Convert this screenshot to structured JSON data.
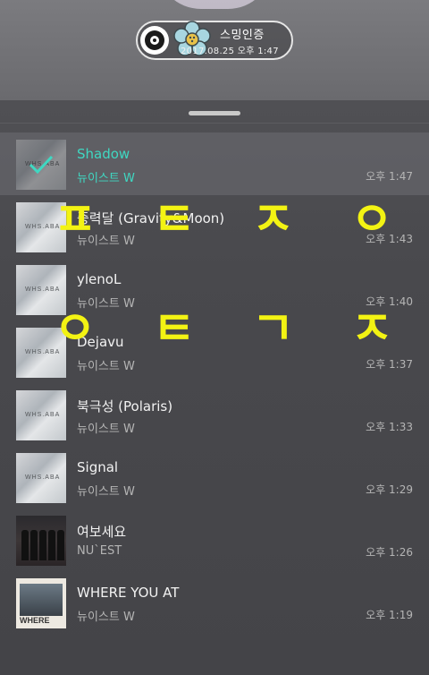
{
  "status_pill": {
    "title": "스밍인증",
    "date": "2017.08.25 오후 1:47"
  },
  "playlist": [
    {
      "title": "Shadow",
      "artist": "뉴이스트 W",
      "time": "오후 1:47",
      "active": true,
      "art": "wh"
    },
    {
      "title": "중력달 (Gravity&Moon)",
      "artist": "뉴이스트 W",
      "time": "오후 1:43",
      "art": "wh"
    },
    {
      "title": "ylenoL",
      "artist": "뉴이스트 W",
      "time": "오후 1:40",
      "art": "wh"
    },
    {
      "title": "Dejavu",
      "artist": "뉴이스트 W",
      "time": "오후 1:37",
      "art": "wh"
    },
    {
      "title": "북극성 (Polaris)",
      "artist": "뉴이스트 W",
      "time": "오후 1:33",
      "art": "wh"
    },
    {
      "title": "Signal",
      "artist": "뉴이스트 W",
      "time": "오후 1:29",
      "art": "wh"
    },
    {
      "title": "여보세요",
      "artist": "NU`EST",
      "time": "오후 1:26",
      "art": "group"
    },
    {
      "title": "WHERE YOU AT",
      "artist": "뉴이스트 W",
      "time": "오후 1:19",
      "art": "where"
    }
  ],
  "album_art_text": {
    "wh": "WHS.ABA",
    "where": "WHERE"
  },
  "overlay_text": {
    "line1": [
      "ㅍ",
      "ㅌ",
      "ㅈ",
      "ㅇ"
    ],
    "line2": [
      "ㅇ",
      "ㅌ",
      "ㄱ",
      "ㅈ"
    ]
  },
  "colors": {
    "active_text": "#3fd8c2",
    "overlay_text": "#f3f313"
  }
}
